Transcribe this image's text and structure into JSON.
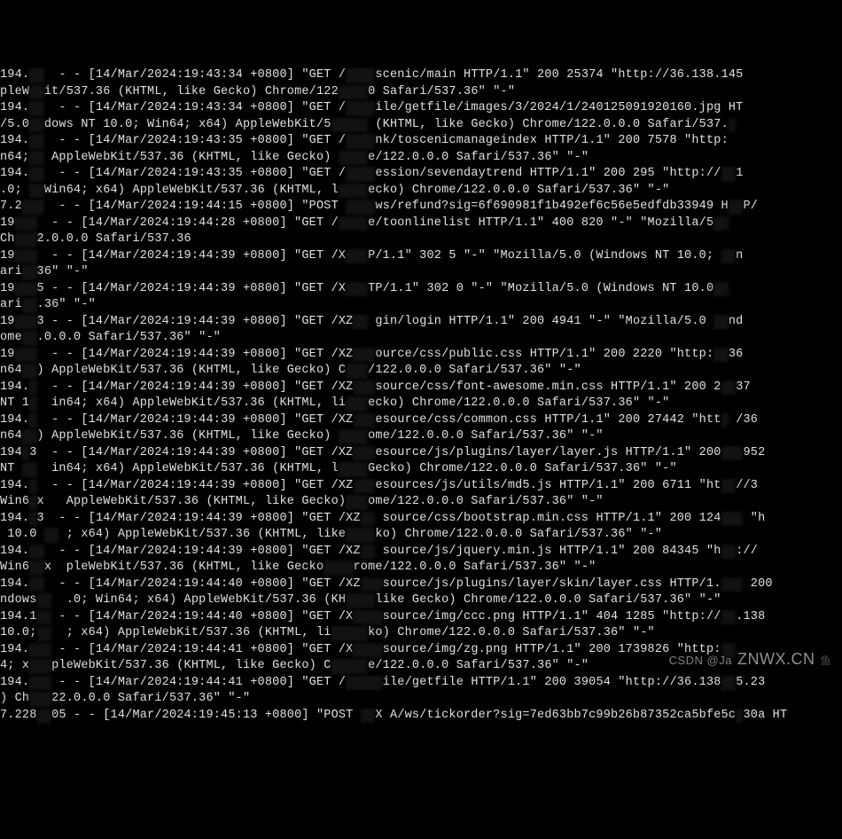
{
  "watermark": {
    "main": "ZNWX.CN",
    "prefix": "CSDN @Ja",
    "suffix": "鱼"
  },
  "log_lines": [
    {
      "segs": [
        {
          "t": "194.",
          "r": false
        },
        {
          "t": "  ",
          "r": true
        },
        {
          "t": "  - - [14/Mar/2024:19:43:34 +0800] \"GET /",
          "r": false
        },
        {
          "t": "    ",
          "r": true
        },
        {
          "t": "scenic/main HTTP/1.1\" 200 25374 \"http://36.138.145",
          "r": false
        }
      ]
    },
    {
      "segs": [
        {
          "t": "pleW",
          "r": false
        },
        {
          "t": "  ",
          "r": true
        },
        {
          "t": "it/537.36 (KHTML, like Gecko) Chrome/122",
          "r": false
        },
        {
          "t": "    ",
          "r": true
        },
        {
          "t": "0 Safari/537.36\" \"-\"",
          "r": false
        }
      ]
    },
    {
      "segs": [
        {
          "t": "194.",
          "r": false
        },
        {
          "t": "  ",
          "r": true
        },
        {
          "t": "  - - [14/Mar/2024:19:43:34 +0800] \"GET /",
          "r": false
        },
        {
          "t": "    ",
          "r": true
        },
        {
          "t": "ile/getfile/images/3/2024/1/240125091920160.jpg HT",
          "r": false
        }
      ]
    },
    {
      "segs": [
        {
          "t": "/5.0",
          "r": false
        },
        {
          "t": "  ",
          "r": true
        },
        {
          "t": "dows NT 10.0; Win64; x64) AppleWebKit/5",
          "r": false
        },
        {
          "t": "     ",
          "r": true
        },
        {
          "t": " (KHTML, like Gecko) Chrome/122.0.0.0 Safari/537.",
          "r": false
        },
        {
          "t": " ",
          "r": true
        }
      ]
    },
    {
      "segs": [
        {
          "t": "194.",
          "r": false
        },
        {
          "t": "  ",
          "r": true
        },
        {
          "t": "  - - [14/Mar/2024:19:43:35 +0800] \"GET /",
          "r": false
        },
        {
          "t": "    ",
          "r": true
        },
        {
          "t": "nk/toscenicmanageindex HTTP/1.1\" 200 7578 \"http:",
          "r": false
        }
      ]
    },
    {
      "segs": [
        {
          "t": "n64;",
          "r": false
        },
        {
          "t": "  ",
          "r": true
        },
        {
          "t": " AppleWebKit/537.36 (KHTML, like Gecko) ",
          "r": false
        },
        {
          "t": "    ",
          "r": true
        },
        {
          "t": "e/122.0.0.0 Safari/537.36\" \"-\"",
          "r": false
        }
      ]
    },
    {
      "segs": [
        {
          "t": "194.",
          "r": false
        },
        {
          "t": "  ",
          "r": true
        },
        {
          "t": "  - - [14/Mar/2024:19:43:35 +0800] \"GET /",
          "r": false
        },
        {
          "t": "    ",
          "r": true
        },
        {
          "t": "ession/sevendaytrend HTTP/1.1\" 200 295 \"http://",
          "r": false
        },
        {
          "t": "  ",
          "r": true
        },
        {
          "t": "1",
          "r": false
        }
      ]
    },
    {
      "segs": [
        {
          "t": ".0; ",
          "r": false
        },
        {
          "t": "  ",
          "r": true
        },
        {
          "t": "Win64; x64) AppleWebKit/537.36 (KHTML, l",
          "r": false
        },
        {
          "t": "    ",
          "r": true
        },
        {
          "t": "ecko) Chrome/122.0.0.0 Safari/537.36\" \"-\"",
          "r": false
        }
      ]
    },
    {
      "segs": [
        {
          "t": "7.2",
          "r": false
        },
        {
          "t": "   ",
          "r": true
        },
        {
          "t": "  - - [14/Mar/2024:19:44:15 +0800] \"POST ",
          "r": false
        },
        {
          "t": "    ",
          "r": true
        },
        {
          "t": "ws/refund?sig=6f690981f1b492ef6c56e5edfdb33949 H",
          "r": false
        },
        {
          "t": "  ",
          "r": true
        },
        {
          "t": "P/",
          "r": false
        }
      ]
    },
    {
      "segs": [
        {
          "t": "19",
          "r": false
        },
        {
          "t": "   ",
          "r": true
        },
        {
          "t": "  - - [14/Mar/2024:19:44:28 +0800] \"GET /",
          "r": false
        },
        {
          "t": "    ",
          "r": true
        },
        {
          "t": "e/toonlinelist HTTP/1.1\" 400 820 \"-\" \"Mozilla/5",
          "r": false
        },
        {
          "t": "  ",
          "r": true
        }
      ]
    },
    {
      "segs": [
        {
          "t": "Ch",
          "r": false
        },
        {
          "t": "   ",
          "r": true
        },
        {
          "t": "2.0.0.0 Safari/537.36",
          "r": false
        }
      ]
    },
    {
      "segs": [
        {
          "t": "19",
          "r": false
        },
        {
          "t": "   ",
          "r": true
        },
        {
          "t": "  - - [14/Mar/2024:19:44:39 +0800] \"GET /X",
          "r": false
        },
        {
          "t": "   ",
          "r": true
        },
        {
          "t": "P/1.1\" 302 5 \"-\" \"Mozilla/5.0 (Windows NT 10.0; ",
          "r": false
        },
        {
          "t": "  ",
          "r": true
        },
        {
          "t": "n",
          "r": false
        }
      ]
    },
    {
      "segs": [
        {
          "t": "ari",
          "r": false
        },
        {
          "t": "  ",
          "r": true
        },
        {
          "t": "36\" \"-\"",
          "r": false
        }
      ]
    },
    {
      "segs": [
        {
          "t": "19",
          "r": false
        },
        {
          "t": "   ",
          "r": true
        },
        {
          "t": "5 - - [14/Mar/2024:19:44:39 +0800] \"GET /X",
          "r": false
        },
        {
          "t": "   ",
          "r": true
        },
        {
          "t": "TP/1.1\" 302 0 \"-\" \"Mozilla/5.0 (Windows NT 10.0",
          "r": false
        },
        {
          "t": "  ",
          "r": true
        }
      ]
    },
    {
      "segs": [
        {
          "t": "ari",
          "r": false
        },
        {
          "t": "  ",
          "r": true
        },
        {
          "t": ".36\" \"-\"",
          "r": false
        }
      ]
    },
    {
      "segs": [
        {
          "t": "19",
          "r": false
        },
        {
          "t": "   ",
          "r": true
        },
        {
          "t": "3 - - [14/Mar/2024:19:44:39 +0800] \"GET /XZ",
          "r": false
        },
        {
          "t": "  ",
          "r": true
        },
        {
          "t": " gin/login HTTP/1.1\" 200 4941 \"-\" \"Mozilla/5.0 ",
          "r": false
        },
        {
          "t": "  ",
          "r": true
        },
        {
          "t": "nd",
          "r": false
        }
      ]
    },
    {
      "segs": [
        {
          "t": "ome",
          "r": false
        },
        {
          "t": "  ",
          "r": true
        },
        {
          "t": ".0.0.0 Safari/537.36\" \"-\"",
          "r": false
        }
      ]
    },
    {
      "segs": [
        {
          "t": "19",
          "r": false
        },
        {
          "t": "   ",
          "r": true
        },
        {
          "t": "  - - [14/Mar/2024:19:44:39 +0800] \"GET /XZ",
          "r": false
        },
        {
          "t": "   ",
          "r": true
        },
        {
          "t": "ource/css/public.css HTTP/1.1\" 200 2220 \"http:",
          "r": false
        },
        {
          "t": "  ",
          "r": true
        },
        {
          "t": "36",
          "r": false
        }
      ]
    },
    {
      "segs": [
        {
          "t": "n64",
          "r": false
        },
        {
          "t": "  ",
          "r": true
        },
        {
          "t": ") AppleWebKit/537.36 (KHTML, like Gecko) C",
          "r": false
        },
        {
          "t": "   ",
          "r": true
        },
        {
          "t": "/122.0.0.0 Safari/537.36\" \"-\"",
          "r": false
        }
      ]
    },
    {
      "segs": [
        {
          "t": "194.",
          "r": false
        },
        {
          "t": " ",
          "r": true
        },
        {
          "t": "  - - [14/Mar/2024:19:44:39 +0800] \"GET /XZ",
          "r": false
        },
        {
          "t": "   ",
          "r": true
        },
        {
          "t": "source/css/font-awesome.min.css HTTP/1.1\" 200 2",
          "r": false
        },
        {
          "t": "  ",
          "r": true
        },
        {
          "t": "37",
          "r": false
        }
      ]
    },
    {
      "segs": [
        {
          "t": "NT 1",
          "r": false
        },
        {
          "t": " ",
          "r": true
        },
        {
          "t": "  in64; x64) AppleWebKit/537.36 (KHTML, li",
          "r": false
        },
        {
          "t": "   ",
          "r": true
        },
        {
          "t": "ecko) Chrome/122.0.0.0 Safari/537.36\" \"-\"",
          "r": false
        }
      ]
    },
    {
      "segs": [
        {
          "t": "194.",
          "r": false
        },
        {
          "t": " ",
          "r": true
        },
        {
          "t": "  - - [14/Mar/2024:19:44:39 +0800] \"GET /XZ",
          "r": false
        },
        {
          "t": "   ",
          "r": true
        },
        {
          "t": "esource/css/common.css HTTP/1.1\" 200 27442 \"htt",
          "r": false
        },
        {
          "t": " ",
          "r": true
        },
        {
          "t": " /36",
          "r": false
        }
      ]
    },
    {
      "segs": [
        {
          "t": "n64",
          "r": false
        },
        {
          "t": "  ",
          "r": true
        },
        {
          "t": ") AppleWebKit/537.36 (KHTML, like Gecko) ",
          "r": false
        },
        {
          "t": "    ",
          "r": true
        },
        {
          "t": "ome/122.0.0.0 Safari/537.36\" \"-\"",
          "r": false
        }
      ]
    },
    {
      "segs": [
        {
          "t": "194",
          "r": false
        },
        {
          "t": " ",
          "r": true
        },
        {
          "t": "3  - - [14/Mar/2024:19:44:39 +0800] \"GET /XZ",
          "r": false
        },
        {
          "t": "   ",
          "r": true
        },
        {
          "t": "esource/js/plugins/layer/layer.js HTTP/1.1\" 200",
          "r": false
        },
        {
          "t": "   ",
          "r": true
        },
        {
          "t": "952",
          "r": false
        }
      ]
    },
    {
      "segs": [
        {
          "t": "NT ",
          "r": false
        },
        {
          "t": "  ",
          "r": true
        },
        {
          "t": "  in64; x64) AppleWebKit/537.36 (KHTML, l",
          "r": false
        },
        {
          "t": "    ",
          "r": true
        },
        {
          "t": "Gecko) Chrome/122.0.0.0 Safari/537.36\" \"-\"",
          "r": false
        }
      ]
    },
    {
      "segs": [
        {
          "t": "194.",
          "r": false
        },
        {
          "t": " ",
          "r": true
        },
        {
          "t": "  - - [14/Mar/2024:19:44:39 +0800] \"GET /XZ",
          "r": false
        },
        {
          "t": "   ",
          "r": true
        },
        {
          "t": "esources/js/utils/md5.js HTTP/1.1\" 200 6711 \"ht",
          "r": false
        },
        {
          "t": "  ",
          "r": true
        },
        {
          "t": "//3",
          "r": false
        }
      ]
    },
    {
      "segs": [
        {
          "t": "Win6",
          "r": false
        },
        {
          "t": " ",
          "r": true
        },
        {
          "t": "x   AppleWebKit/537.36 (KHTML, like Gecko)",
          "r": false
        },
        {
          "t": "   ",
          "r": true
        },
        {
          "t": "ome/122.0.0.0 Safari/537.36\" \"-\"",
          "r": false
        }
      ]
    },
    {
      "segs": [
        {
          "t": "194.",
          "r": false
        },
        {
          "t": " ",
          "r": true
        },
        {
          "t": "3  - - [14/Mar/2024:19:44:39 +0800] \"GET /XZ",
          "r": false
        },
        {
          "t": "  ",
          "r": true
        },
        {
          "t": " source/css/bootstrap.min.css HTTP/1.1\" 200 124",
          "r": false
        },
        {
          "t": "   ",
          "r": true
        },
        {
          "t": " \"h",
          "r": false
        }
      ]
    },
    {
      "segs": [
        {
          "t": " 10.0 ",
          "r": false
        },
        {
          "t": "  ",
          "r": true
        },
        {
          "t": " ; x64) AppleWebKit/537.36 (KHTML, like",
          "r": false
        },
        {
          "t": "    ",
          "r": true
        },
        {
          "t": "ko) Chrome/122.0.0.0 Safari/537.36\" \"-\"",
          "r": false
        }
      ]
    },
    {
      "segs": [
        {
          "t": "194.",
          "r": false
        },
        {
          "t": "  ",
          "r": true
        },
        {
          "t": "  - - [14/Mar/2024:19:44:39 +0800] \"GET /XZ",
          "r": false
        },
        {
          "t": "  ",
          "r": true
        },
        {
          "t": " source/js/jquery.min.js HTTP/1.1\" 200 84345 \"h",
          "r": false
        },
        {
          "t": "  ",
          "r": true
        },
        {
          "t": "://",
          "r": false
        }
      ]
    },
    {
      "segs": [
        {
          "t": "Win6",
          "r": false
        },
        {
          "t": "  ",
          "r": true
        },
        {
          "t": "x  pleWebKit/537.36 (KHTML, like Gecko",
          "r": false
        },
        {
          "t": "    ",
          "r": true
        },
        {
          "t": "rome/122.0.0.0 Safari/537.36\" \"-\"",
          "r": false
        }
      ]
    },
    {
      "segs": [
        {
          "t": "194.",
          "r": false
        },
        {
          "t": "  ",
          "r": true
        },
        {
          "t": "  - - [14/Mar/2024:19:44:40 +0800] \"GET /XZ",
          "r": false
        },
        {
          "t": "   ",
          "r": true
        },
        {
          "t": "source/js/plugins/layer/skin/layer.css HTTP/1.",
          "r": false
        },
        {
          "t": "   ",
          "r": true
        },
        {
          "t": " 200",
          "r": false
        }
      ]
    },
    {
      "segs": [
        {
          "t": "ndows",
          "r": false
        },
        {
          "t": "  ",
          "r": true
        },
        {
          "t": "  .0; Win64; x64) AppleWebKit/537.36 (KH",
          "r": false
        },
        {
          "t": "    ",
          "r": true
        },
        {
          "t": "like Gecko) Chrome/122.0.0.0 Safari/537.36\" \"-\"",
          "r": false
        }
      ]
    },
    {
      "segs": [
        {
          "t": "194.1",
          "r": false
        },
        {
          "t": "  ",
          "r": true
        },
        {
          "t": " - - [14/Mar/2024:19:44:40 +0800] \"GET /X",
          "r": false
        },
        {
          "t": "    ",
          "r": true
        },
        {
          "t": "source/img/ccc.png HTTP/1.1\" 404 1285 \"http://",
          "r": false
        },
        {
          "t": "  ",
          "r": true
        },
        {
          "t": ".138",
          "r": false
        }
      ]
    },
    {
      "segs": [
        {
          "t": "10.0;",
          "r": false
        },
        {
          "t": "  ",
          "r": true
        },
        {
          "t": "  ; x64) AppleWebKit/537.36 (KHTML, li",
          "r": false
        },
        {
          "t": "     ",
          "r": true
        },
        {
          "t": "ko) Chrome/122.0.0.0 Safari/537.36\" \"-\"",
          "r": false
        }
      ]
    },
    {
      "segs": [
        {
          "t": "194.",
          "r": false
        },
        {
          "t": "   ",
          "r": true
        },
        {
          "t": " - - [14/Mar/2024:19:44:41 +0800] \"GET /X",
          "r": false
        },
        {
          "t": "    ",
          "r": true
        },
        {
          "t": "source/img/zg.png HTTP/1.1\" 200 1739826 \"http:",
          "r": false
        },
        {
          "t": "  ",
          "r": true
        }
      ]
    },
    {
      "segs": [
        {
          "t": "4; x",
          "r": false
        },
        {
          "t": "   ",
          "r": true
        },
        {
          "t": "pleWebKit/537.36 (KHTML, like Gecko) C",
          "r": false
        },
        {
          "t": "     ",
          "r": true
        },
        {
          "t": "e/122.0.0.0 Safari/537.36\" \"-\"",
          "r": false
        }
      ]
    },
    {
      "segs": [
        {
          "t": "194.",
          "r": false
        },
        {
          "t": "   ",
          "r": true
        },
        {
          "t": " - - [14/Mar/2024:19:44:41 +0800] \"GET /",
          "r": false
        },
        {
          "t": "     ",
          "r": true
        },
        {
          "t": "ile/getfile HTTP/1.1\" 200 39054 \"http://36.138",
          "r": false
        },
        {
          "t": "  ",
          "r": true
        },
        {
          "t": "5.23",
          "r": false
        }
      ]
    },
    {
      "segs": [
        {
          "t": ") Ch",
          "r": false
        },
        {
          "t": "   ",
          "r": true
        },
        {
          "t": "22.0.0.0 Safari/537.36\" \"-\"",
          "r": false
        }
      ]
    },
    {
      "segs": [
        {
          "t": "7.228",
          "r": false
        },
        {
          "t": "  ",
          "r": true
        },
        {
          "t": "05 - - [14/Mar/2024:19:45:13 +0800] \"POST ",
          "r": false
        },
        {
          "t": "  ",
          "r": true
        },
        {
          "t": "X A/ws/tickorder?sig=7ed63bb7c99b26b87352ca5bfe5c",
          "r": false
        },
        {
          "t": " ",
          "r": true
        },
        {
          "t": "30a HT",
          "r": false
        }
      ]
    }
  ]
}
